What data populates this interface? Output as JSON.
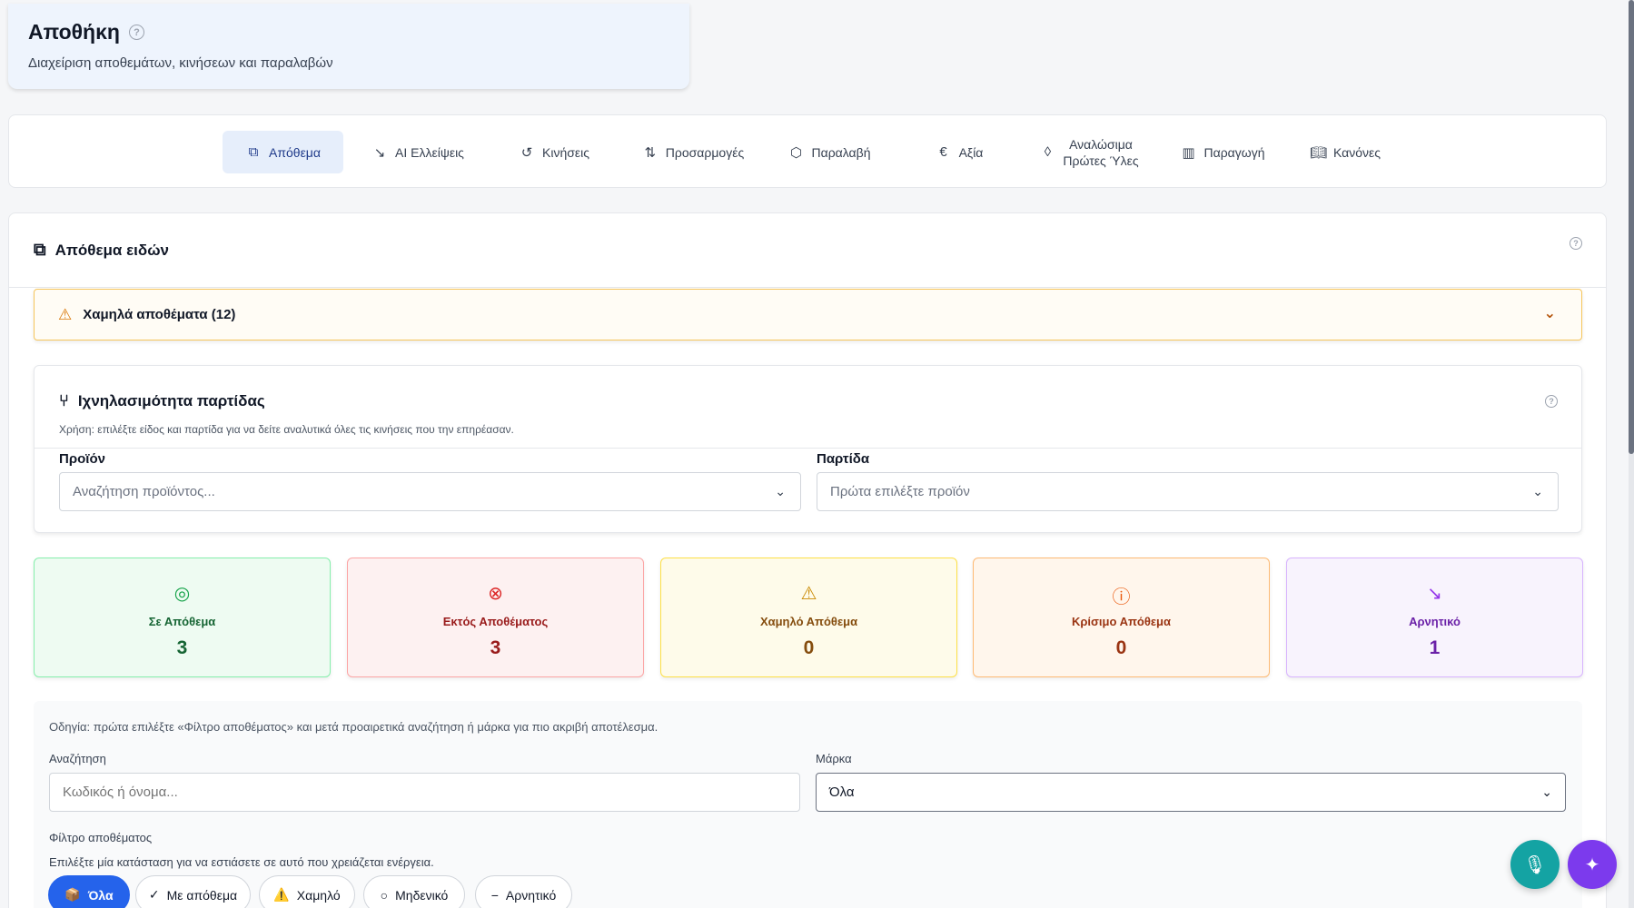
{
  "header": {
    "title": "Αποθήκη",
    "subtitle": "Διαχείριση αποθεμάτων, κινήσεων και παραλαβών",
    "help": "?"
  },
  "tabs": [
    {
      "label": "Απόθεμα",
      "icon": "boxes-icon"
    },
    {
      "label": "AI Ελλείψεις",
      "icon": "trend-down-icon"
    },
    {
      "label": "Κινήσεις",
      "icon": "history-icon"
    },
    {
      "label": "Προσαρμογές",
      "icon": "arrows-updown-icon"
    },
    {
      "label": "Παραλαβή",
      "icon": "package-icon"
    },
    {
      "label": "Αξία",
      "icon": "euro-icon"
    },
    {
      "label_line1": "Αναλώσιμα",
      "label_line2": "Πρώτες Ύλες",
      "icon": "droplet-icon"
    },
    {
      "label": "Παραγωγή",
      "icon": "factory-icon"
    },
    {
      "label": "Κανόνες",
      "icon": "book-icon"
    }
  ],
  "main": {
    "title": "Απόθεμα ειδών",
    "alert": {
      "label": "Χαμηλά αποθέματα (12)"
    }
  },
  "trace": {
    "title": "Ιχνηλασιμότητα παρτίδας",
    "description": "Χρήση: επιλέξτε είδος και παρτίδα για να δείτε αναλυτικά όλες τις κινήσεις που την επηρέασαν.",
    "product_label": "Προϊόν",
    "product_placeholder": "Αναζήτηση προϊόντος...",
    "batch_label": "Παρτίδα",
    "batch_placeholder": "Πρώτα επιλέξτε προϊόν"
  },
  "stats": [
    {
      "label": "Σε Απόθεμα",
      "value": "3",
      "bg": "#eefbf2",
      "border": "#86efac",
      "color": "#166534",
      "icon_color": "#16a34a"
    },
    {
      "label": "Εκτός Αποθέματος",
      "value": "3",
      "bg": "#fdf1f1",
      "border": "#fca5a5",
      "color": "#991b1b",
      "icon_color": "#dc2626"
    },
    {
      "label": "Χαμηλό Απόθεμα",
      "value": "0",
      "bg": "#fefbea",
      "border": "#fde047",
      "color": "#854d0e",
      "icon_color": "#ca8a04"
    },
    {
      "label": "Κρίσιμο Απόθεμα",
      "value": "0",
      "bg": "#fff6ec",
      "border": "#fdba74",
      "color": "#9a3412",
      "icon_color": "#ea580c"
    },
    {
      "label": "Αρνητικό",
      "value": "1",
      "bg": "#f8f3fd",
      "border": "#d8b4fe",
      "color": "#6b21a8",
      "icon_color": "#9333ea"
    }
  ],
  "filters": {
    "note": "Οδηγία: πρώτα επιλέξτε «Φίλτρο αποθέματος» και μετά προαιρετικά αναζήτηση ή μάρκα για πιο ακριβή αποτέλεσμα.",
    "search_label": "Αναζήτηση",
    "search_placeholder": "Κωδικός ή όνομα...",
    "brand_label": "Μάρκα",
    "brand_value": "Όλα",
    "stock_filter_label": "Φίλτρο αποθέματος",
    "stock_filter_help": "Επιλέξτε μία κατάσταση για να εστιάσετε σε αυτό που χρειάζεται ενέργεια.",
    "chips": [
      {
        "label": "Όλα",
        "icon": "📦",
        "active": true
      },
      {
        "label": "Με απόθεμα",
        "icon": "✓",
        "active": false
      },
      {
        "label": "Χαμηλό",
        "icon": "⚠️",
        "active": false
      },
      {
        "label": "Μηδενικό",
        "icon": "○",
        "active": false
      },
      {
        "label": "Αρνητικό",
        "icon": "−",
        "active": false
      }
    ]
  },
  "colors": {
    "accent": "#2563eb",
    "mic_fab": "#14a3a3",
    "ai_fab": "#7c3aed"
  }
}
